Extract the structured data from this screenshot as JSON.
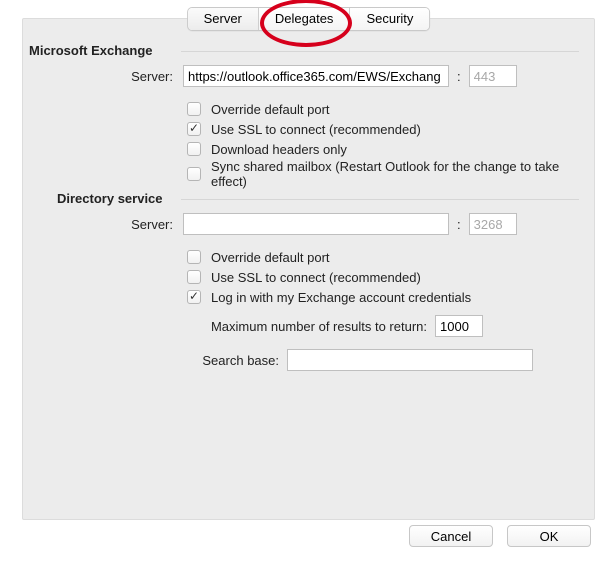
{
  "tabs": {
    "server": "Server",
    "delegates": "Delegates",
    "security": "Security"
  },
  "exchange": {
    "title": "Microsoft Exchange",
    "server_label": "Server:",
    "server_value": "https://outlook.office365.com/EWS/Exchang",
    "port_value": "443",
    "override_port": "Override default port",
    "use_ssl": "Use SSL to connect (recommended)",
    "dl_headers": "Download headers only",
    "sync_shared": "Sync shared mailbox (Restart Outlook for the change to take effect)"
  },
  "directory": {
    "title": "Directory service",
    "server_label": "Server:",
    "server_value": "",
    "port_value": "3268",
    "override_port": "Override default port",
    "use_ssl": "Use SSL to connect (recommended)",
    "login_exch": "Log in with my Exchange account credentials",
    "max_results_label": "Maximum number of results to return:",
    "max_results_value": "1000",
    "search_base_label": "Search base:",
    "search_base_value": ""
  },
  "footer": {
    "cancel": "Cancel",
    "ok": "OK"
  }
}
